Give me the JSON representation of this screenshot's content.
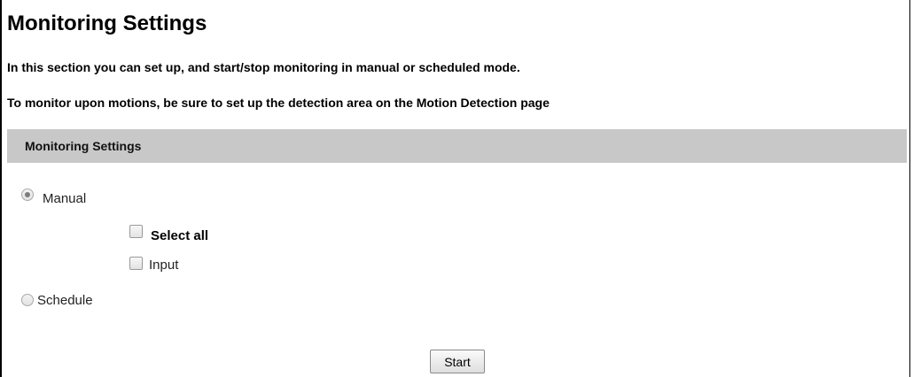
{
  "page": {
    "title": "Monitoring Settings",
    "intro_1": "In this section you can set up, and start/stop monitoring in manual or scheduled mode.",
    "intro_2": "To monitor upon motions, be sure to set up the detection area on the Motion Detection page"
  },
  "section": {
    "title": "Monitoring Settings",
    "header_color": "#c8c8c8"
  },
  "options": {
    "manual": {
      "label": "Manual",
      "checked": true
    },
    "select_all": {
      "label": "Select all",
      "checked": false
    },
    "input": {
      "label": "Input",
      "checked": false
    },
    "schedule": {
      "label": "Schedule",
      "checked": false
    }
  },
  "actions": {
    "start_label": "Start"
  }
}
